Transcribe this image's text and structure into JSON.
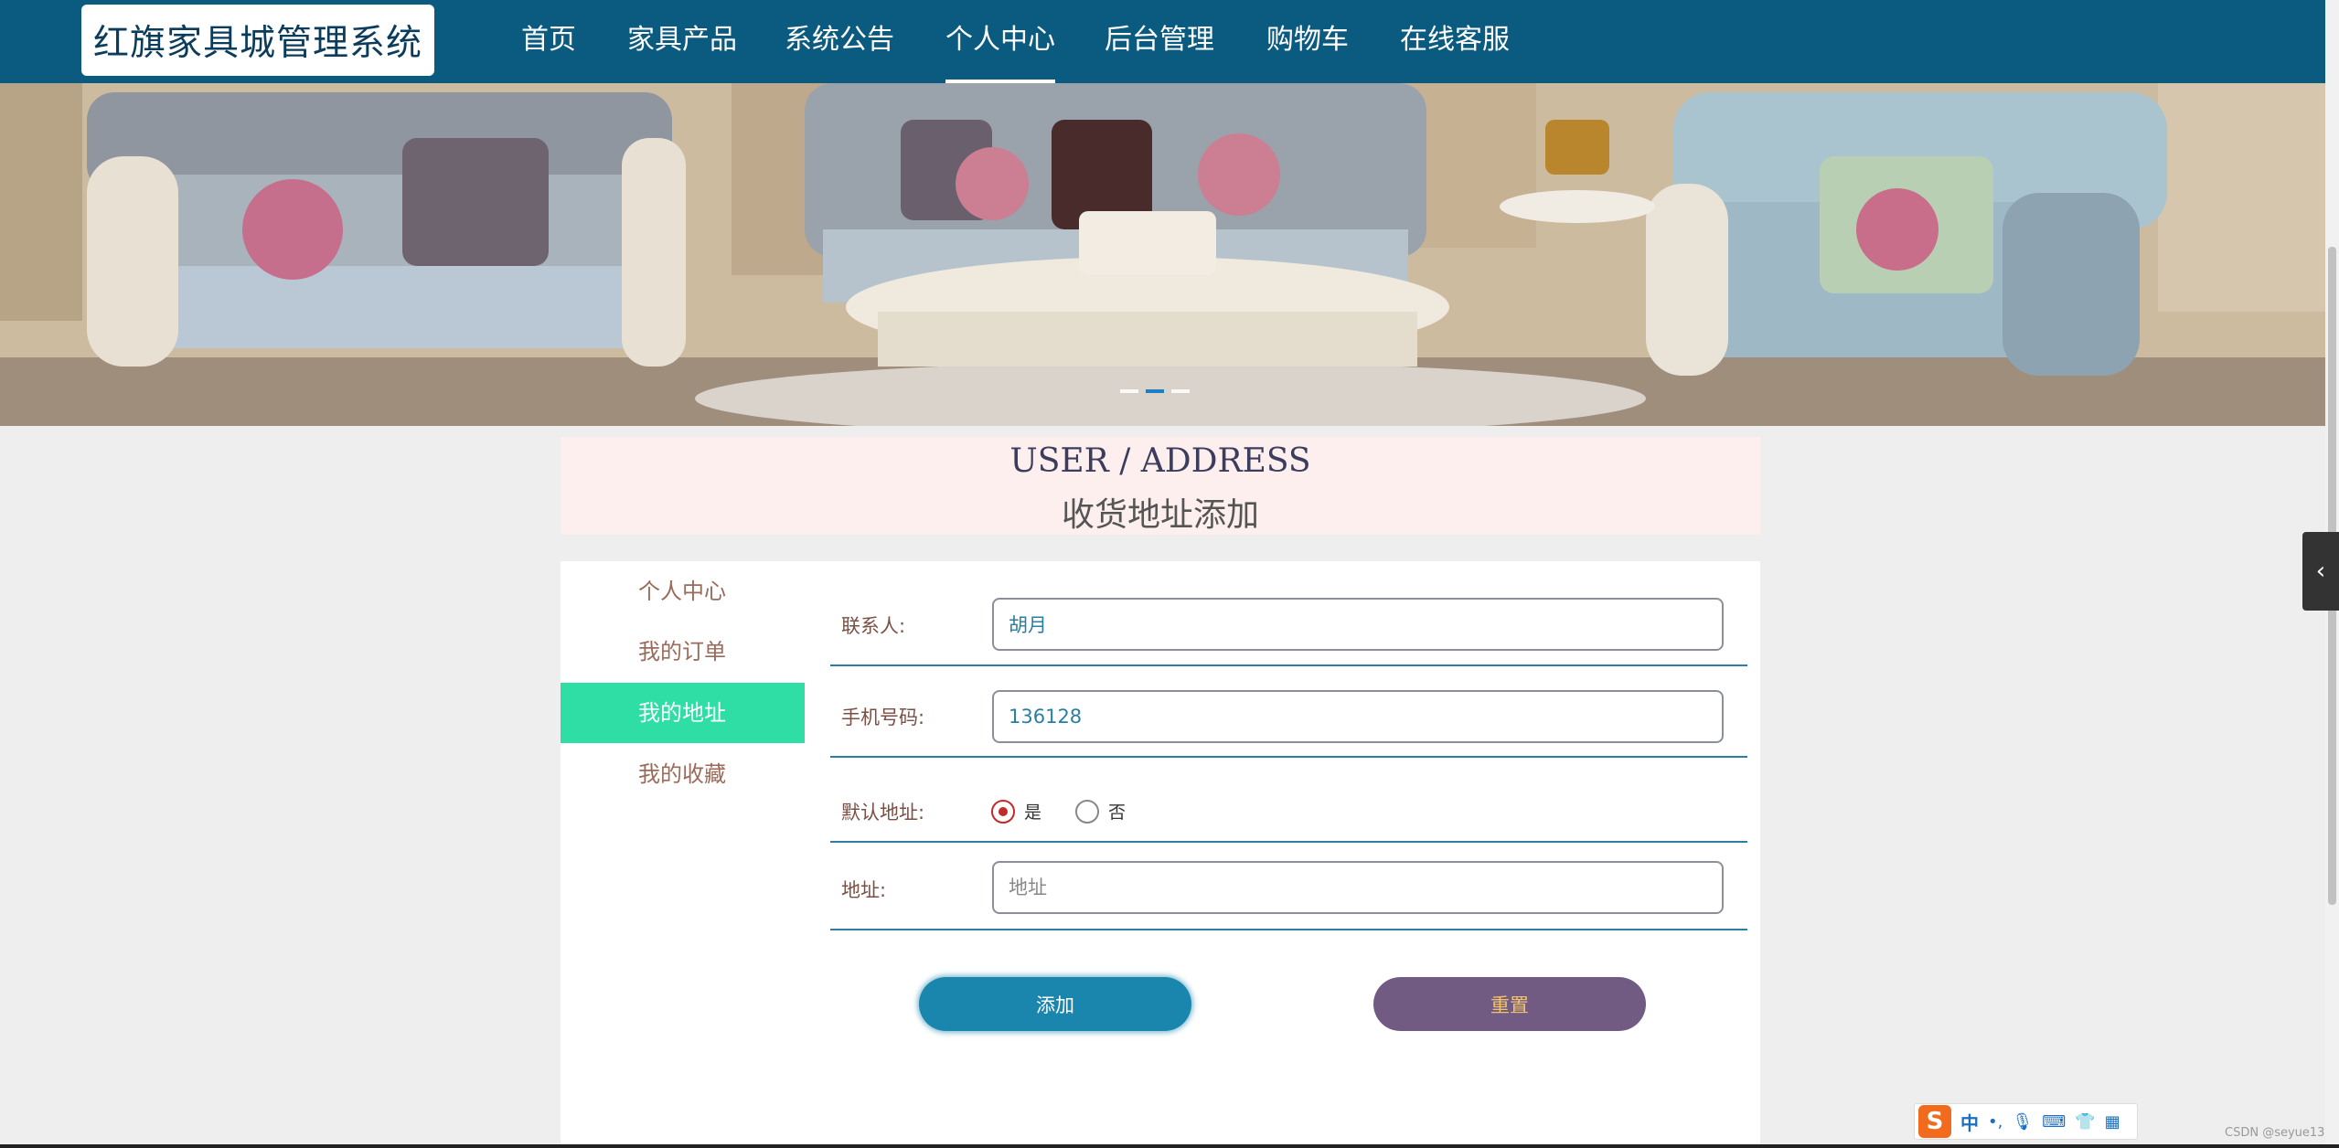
{
  "brand": {
    "title": "红旗家具城管理系统"
  },
  "nav": {
    "items": [
      {
        "label": "首页",
        "active": false
      },
      {
        "label": "家具产品",
        "active": false
      },
      {
        "label": "系统公告",
        "active": false
      },
      {
        "label": "个人中心",
        "active": true
      },
      {
        "label": "后台管理",
        "active": false
      },
      {
        "label": "购物车",
        "active": false
      },
      {
        "label": "在线客服",
        "active": false
      }
    ]
  },
  "banner": {
    "slides": 3,
    "active_slide": 2
  },
  "section": {
    "title_en": "USER / ADDRESS",
    "title_cn": "收货地址添加"
  },
  "sidebar": {
    "items": [
      {
        "label": "个人中心",
        "active": false
      },
      {
        "label": "我的订单",
        "active": false
      },
      {
        "label": "我的地址",
        "active": true
      },
      {
        "label": "我的收藏",
        "active": false
      }
    ]
  },
  "form": {
    "contact": {
      "label": "联系人:",
      "value": "胡月"
    },
    "phone": {
      "label": "手机号码:",
      "value": "136128"
    },
    "default": {
      "label": "默认地址:",
      "options": [
        {
          "label": "是",
          "checked": true
        },
        {
          "label": "否",
          "checked": false
        }
      ]
    },
    "address": {
      "label": "地址:",
      "value": "",
      "placeholder": "地址"
    },
    "add_button": "添加",
    "reset_button": "重置"
  },
  "ime": {
    "logo": "S",
    "mode": "中",
    "icons": [
      "punctuation-icon",
      "mic-icon",
      "keyboard-icon",
      "skin-icon",
      "apps-icon"
    ]
  },
  "watermark": "CSDN @seyue13",
  "colors": {
    "nav_bg": "#0b5a80",
    "sidebar_active": "#2fdea5",
    "section_bg": "#fcefed",
    "add_button": "#1a86ad",
    "reset_button": "#725b82",
    "radio_checked": "#c12b2b"
  }
}
